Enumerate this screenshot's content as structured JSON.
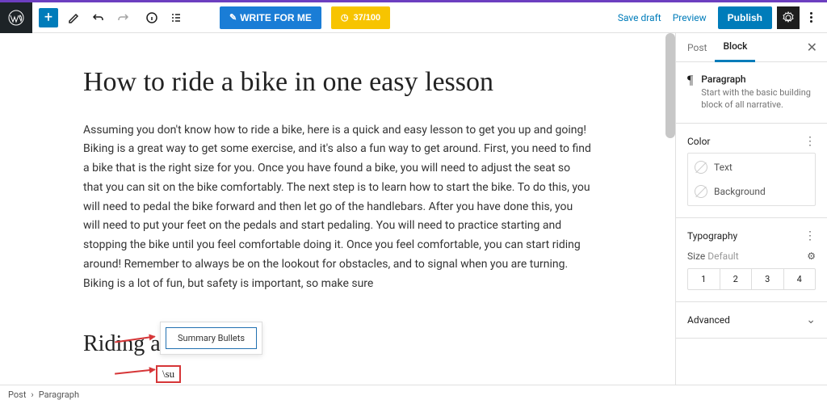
{
  "toolbar": {
    "write_label": "WRITE FOR ME",
    "credits": "37/100",
    "save_draft": "Save draft",
    "preview": "Preview",
    "publish": "Publish"
  },
  "editor": {
    "title": "How to ride a bike in one easy lesson",
    "paragraph": "Assuming you don't know how to ride a bike, here is a quick and easy lesson to get you up and going! Biking is a great way to get some exercise, and it's also a fun way to get around. First, you need to find a bike that is the right size for you. Once you have found a bike, you will need to adjust the seat so that you can sit on the bike comfortably. The next step is to learn how to start the bike. To do this, you will need to pedal the bike forward and then let go of the handlebars. After you have done this, you will need to put your feet on the pedals and start pedaling. You will need to practice starting and stopping the bike until you feel comfortable doing it. Once you feel comfortable, you can start riding around! Remember to always be on the lookout for obstacles, and to signal when you are turning. Biking is a lot of fun, but safety is important, so make sure",
    "suggestion": "Summary Bullets",
    "typed": "\\su",
    "subtitle": "Riding around"
  },
  "sidebar": {
    "tab_post": "Post",
    "tab_block": "Block",
    "block_name": "Paragraph",
    "block_desc": "Start with the basic building block of all narrative.",
    "panel_color": "Color",
    "color_text": "Text",
    "color_bg": "Background",
    "panel_typo": "Typography",
    "size_label": "Size",
    "size_default": "Default",
    "sizes": [
      "1",
      "2",
      "3",
      "4"
    ],
    "panel_advanced": "Advanced"
  },
  "breadcrumb": {
    "root": "Post",
    "current": "Paragraph"
  }
}
